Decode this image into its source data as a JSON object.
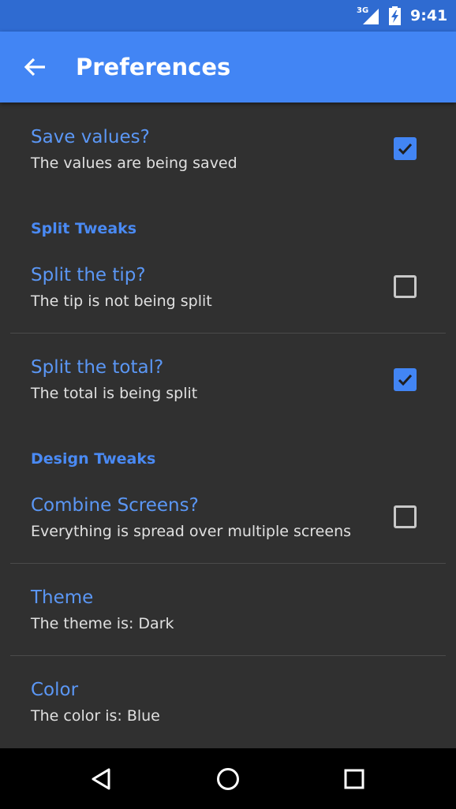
{
  "status_bar": {
    "network": "3G",
    "time": "9:41"
  },
  "app_bar": {
    "title": "Preferences",
    "back_icon": "arrow-back-icon"
  },
  "prefs": {
    "save_values": {
      "title": "Save values?",
      "summary": "The values are being saved",
      "checked": true
    },
    "split_tweaks": {
      "category": "Split Tweaks"
    },
    "split_tip": {
      "title": "Split the tip?",
      "summary": "The tip is not being split",
      "checked": false
    },
    "split_total": {
      "title": "Split the total?",
      "summary": "The total is being split",
      "checked": true
    },
    "design_tweaks": {
      "category": "Design Tweaks"
    },
    "combine_screens": {
      "title": "Combine Screens?",
      "summary": "Everything is spread over multiple screens",
      "checked": false
    },
    "theme": {
      "title": "Theme",
      "summary": "The theme is: Dark"
    },
    "color": {
      "title": "Color",
      "summary": "The color is: Blue"
    }
  },
  "colors": {
    "status_bar": "#2f6bd1",
    "app_bar": "#4285f4",
    "background": "#303030",
    "accent": "#4285f4"
  },
  "nav_bar": {
    "icons": [
      "back-triangle-icon",
      "home-circle-icon",
      "recents-square-icon"
    ]
  }
}
